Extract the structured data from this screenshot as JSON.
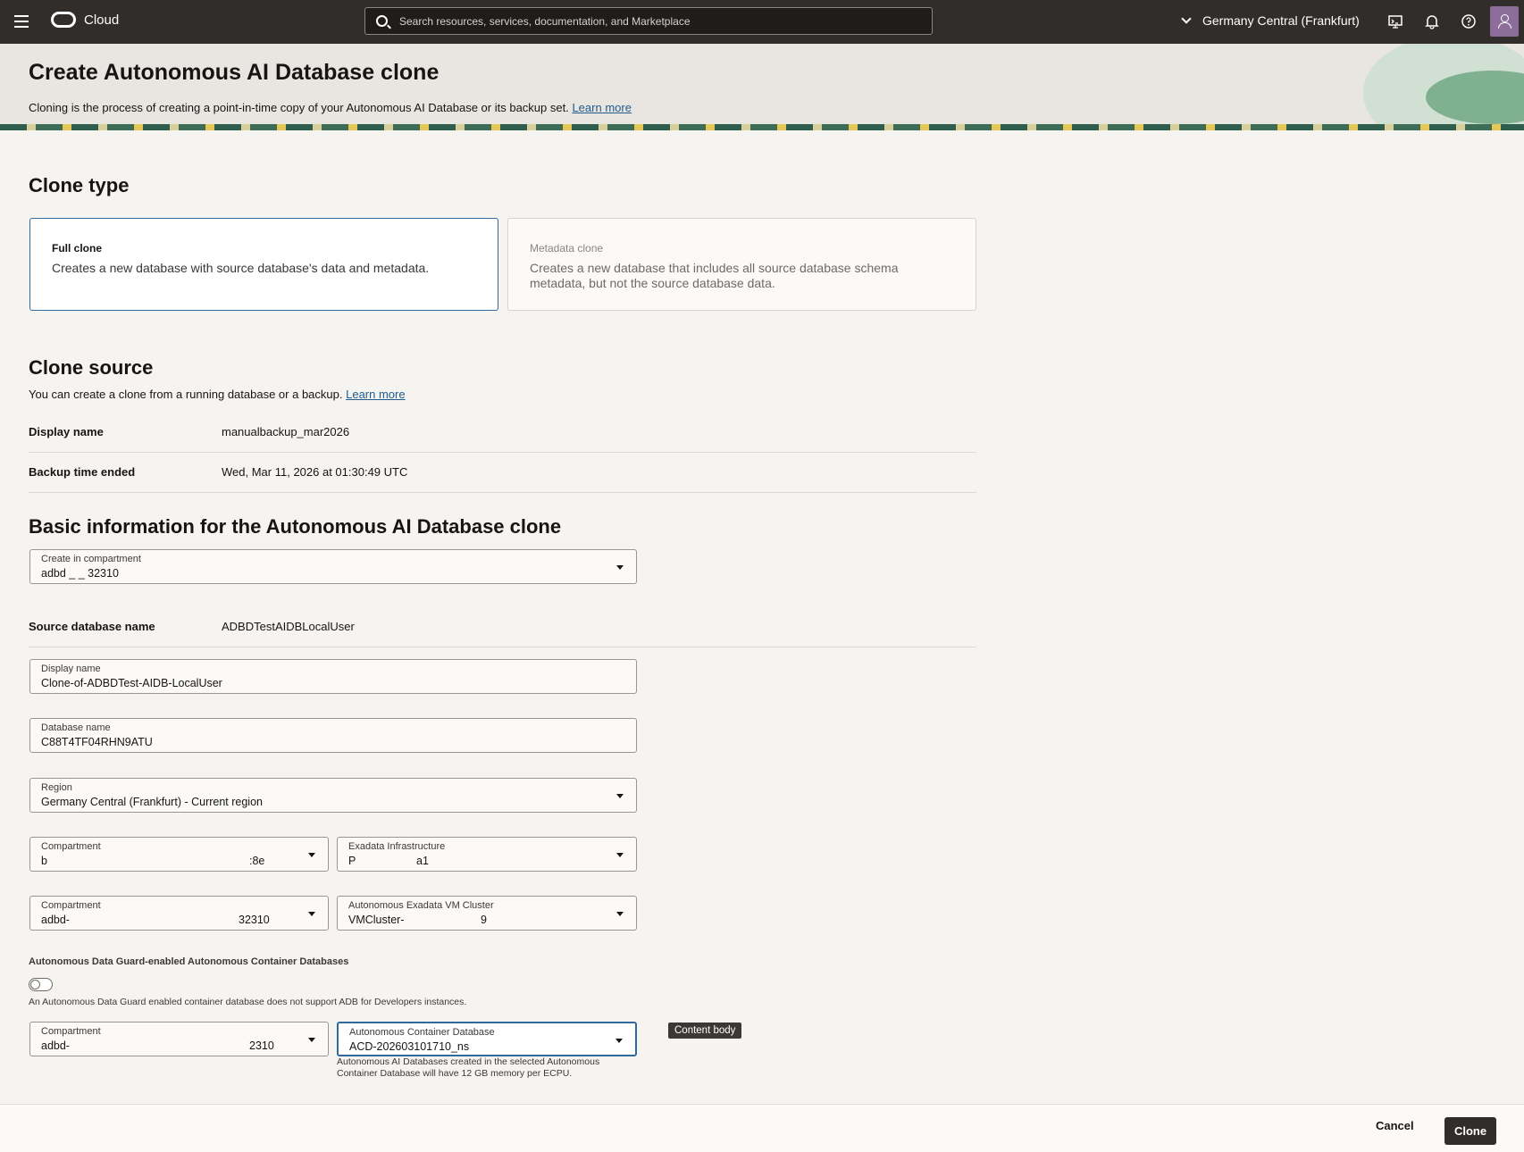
{
  "topbar": {
    "brand": "Cloud",
    "search_placeholder": "Search resources, services, documentation, and Marketplace",
    "region": "Germany Central (Frankfurt)"
  },
  "header": {
    "title": "Create Autonomous AI Database clone",
    "description": "Cloning is the process of creating a point-in-time copy of your Autonomous AI Database or its backup set.",
    "learn_more": "Learn more"
  },
  "clone_type": {
    "heading": "Clone type",
    "options": [
      {
        "title": "Full clone",
        "description": "Creates a new database with source database's data and metadata.",
        "selected": true
      },
      {
        "title": "Metadata clone",
        "description": "Creates a new database that includes all source database schema metadata, but not the source database data.",
        "selected": false
      }
    ]
  },
  "clone_source": {
    "heading": "Clone source",
    "description": "You can create a clone from a running database or a backup.",
    "learn_more": "Learn more",
    "display_name_label": "Display name",
    "display_name_value": "manualbackup_mar2026",
    "backup_time_label": "Backup time ended",
    "backup_time_value": "Wed, Mar 11, 2026 at 01:30:49 UTC"
  },
  "basic_info": {
    "heading": "Basic information for the Autonomous AI Database clone",
    "create_in_compartment": {
      "label": "Create in compartment",
      "value": "adbd                _               _               32310"
    },
    "source_db_label": "Source database name",
    "source_db_value": "ADBDTestAIDBLocalUser",
    "display_name": {
      "label": "Display name",
      "value": "Clone-of-ADBDTest-AIDB-LocalUser"
    },
    "database_name": {
      "label": "Database name",
      "value": "C88T4TF04RHN9ATU"
    },
    "region": {
      "label": "Region",
      "value": "Germany Central (Frankfurt) - Current region"
    },
    "compartment_1": {
      "label": "Compartment",
      "value": "b",
      "suffix": ":8e"
    },
    "exadata_infra": {
      "label": "Exadata Infrastructure",
      "value": "P",
      "suffix": "a1"
    },
    "compartment_2": {
      "label": "Compartment",
      "value": "adbd-",
      "suffix": "32310"
    },
    "vm_cluster": {
      "label": "Autonomous Exadata VM Cluster",
      "value": "VMCluster-",
      "suffix": "9"
    },
    "data_guard_label": "Autonomous Data Guard-enabled Autonomous Container Databases",
    "data_guard_hint": "An Autonomous Data Guard enabled container database does not support ADB for Developers instances.",
    "compartment_3": {
      "label": "Compartment",
      "value": "adbd-",
      "suffix": "2310"
    },
    "container_db": {
      "label": "Autonomous Container Database",
      "value": "ACD-202603101710_ns"
    },
    "container_db_hint": "Autonomous AI Databases created in the selected Autonomous Container Database will have 12 GB memory per ECPU."
  },
  "tooltip": "Content body",
  "footer": {
    "cancel": "Cancel",
    "clone": "Clone"
  }
}
